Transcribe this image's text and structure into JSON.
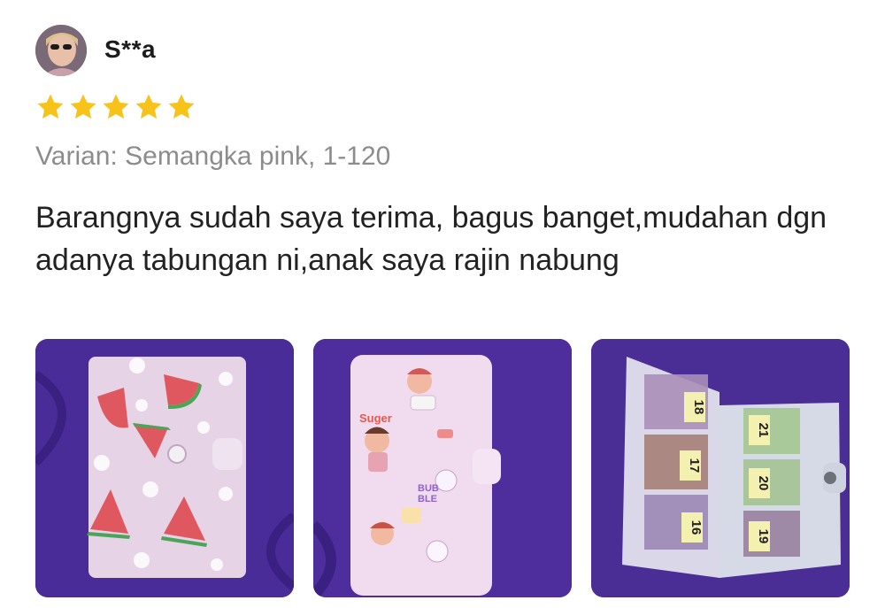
{
  "review": {
    "username": "S**a",
    "avatar_icon": "user-avatar",
    "rating": 5,
    "rating_max": 5,
    "star_color": "#f7c31a",
    "variant": "Varian: Semangka pink, 1-120",
    "comment": "Barangnya sudah saya terima, bagus banget,mudahan dgn adanya tabungan ni,anak saya rajin nabung",
    "photos": [
      {
        "icon": "watermelon-binder-photo"
      },
      {
        "icon": "sticker-binder-photo",
        "sticker_texts": [
          "Suger",
          "BUB",
          "BLE"
        ]
      },
      {
        "icon": "open-binder-photo",
        "page_numbers": [
          "18",
          "17",
          "16",
          "21",
          "20",
          "19"
        ]
      }
    ]
  }
}
